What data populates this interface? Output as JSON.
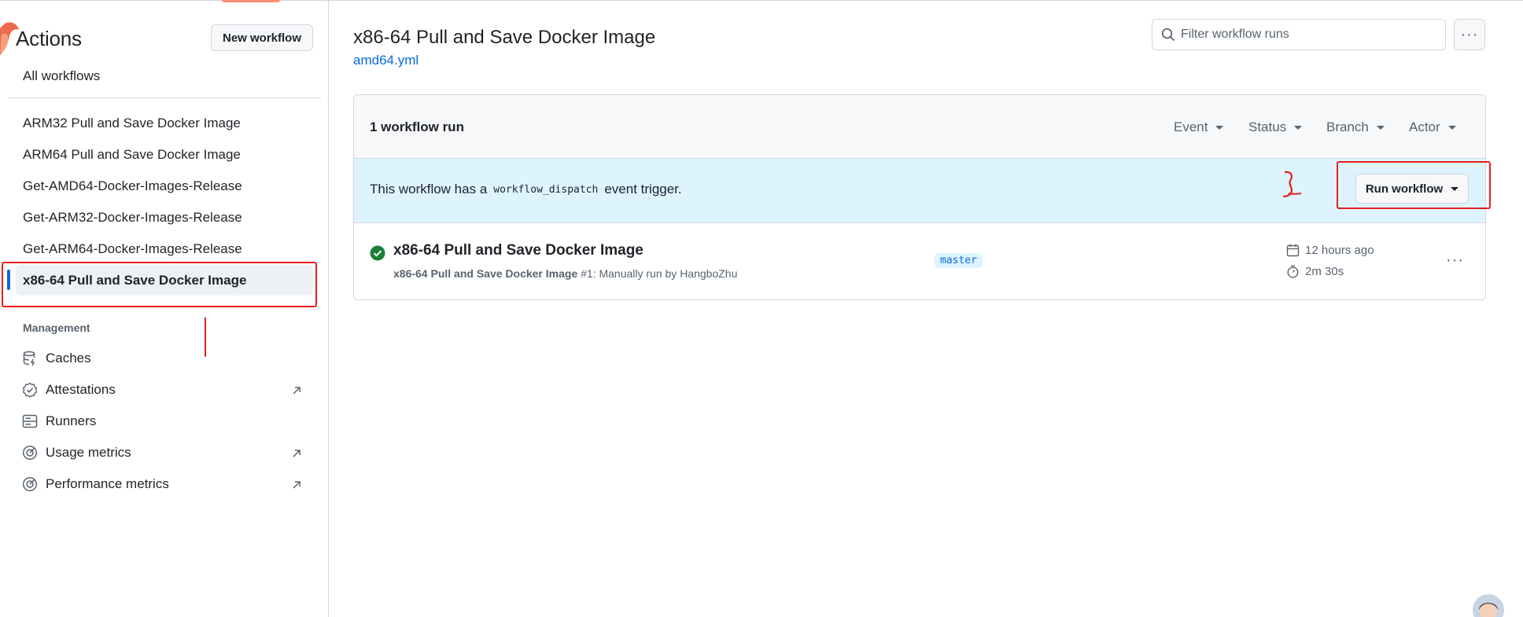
{
  "sidebar": {
    "title": "Actions",
    "new_workflow_label": "New workflow",
    "all_workflows_label": "All workflows",
    "workflows": [
      "ARM32 Pull and Save Docker Image",
      "ARM64 Pull and Save Docker Image",
      "Get-AMD64-Docker-Images-Release",
      "Get-ARM32-Docker-Images-Release",
      "Get-ARM64-Docker-Images-Release",
      "x86-64 Pull and Save Docker Image"
    ],
    "selected_workflow": "x86-64 Pull and Save Docker Image",
    "management_label": "Management",
    "management": {
      "caches": {
        "label": "Caches",
        "icon": "database-icon"
      },
      "attestations": {
        "label": "Attestations",
        "icon": "verified-icon"
      },
      "runners": {
        "label": "Runners",
        "icon": "server-icon"
      },
      "usage_metrics": {
        "label": "Usage metrics",
        "icon": "meter-icon"
      },
      "performance_metrics": {
        "label": "Performance metrics",
        "icon": "meter-icon"
      }
    }
  },
  "main": {
    "title": "x86-64 Pull and Save Docker Image",
    "workflow_file": "amd64.yml",
    "filter_placeholder": "Filter workflow runs",
    "runs_count": "1 workflow run",
    "filters": {
      "event": "Event",
      "status": "Status",
      "branch": "Branch",
      "actor": "Actor"
    },
    "dispatch": {
      "text_before": "This workflow has a",
      "code": "workflow_dispatch",
      "text_after": "event trigger.",
      "run_button": "Run workflow"
    },
    "run": {
      "name": "x86-64 Pull and Save Docker Image",
      "meta_workflow": "x86-64 Pull and Save Docker Image",
      "meta_detail": "#1: Manually run by HangboZhu",
      "branch": "master",
      "time_ago": "12 hours ago",
      "duration": "2m 30s",
      "status": "success"
    }
  },
  "colors": {
    "accent": "#0969da",
    "success": "#1a7f37",
    "annotation": "#e81e1e",
    "dispatch_bg": "#ddf4ff"
  }
}
